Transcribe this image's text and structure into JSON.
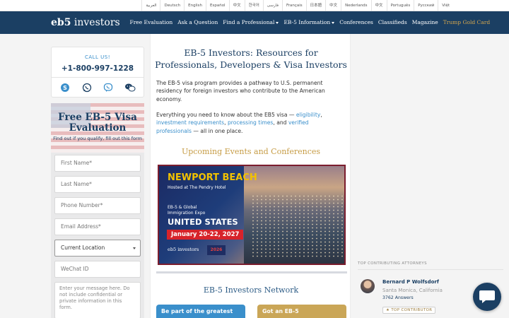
{
  "languages": [
    "العربية",
    "Deutsch",
    "English",
    "Español",
    "中文",
    "한국어",
    "فارسی",
    "Français",
    "日本語",
    "中文",
    "Nederlands",
    "中文",
    "Português",
    "Русский",
    "Việt"
  ],
  "nav": {
    "logo_bold": "eb5",
    "logo_rest": "investors",
    "items": [
      {
        "label": "Free Evaluation"
      },
      {
        "label": "Ask a Question"
      },
      {
        "label": "Find a Professional",
        "dropdown": true
      },
      {
        "label": "EB-5 Information",
        "dropdown": true
      },
      {
        "label": "Conferences"
      },
      {
        "label": "Classifieds"
      },
      {
        "label": "Magazine"
      },
      {
        "label": "Trump Gold Card",
        "accent": "#d6a84e"
      }
    ]
  },
  "sidebar": {
    "call_label": "CALL US!",
    "phone": "+1-800-997-1228",
    "contact_icons": [
      "skype-icon",
      "whatsapp-icon",
      "viber-icon",
      "wechat-icon"
    ],
    "form": {
      "title": "Free EB-5 Visa Evaluation",
      "subtitle": "Find out if you qualify, fill out this form",
      "first_name": "First Name*",
      "last_name": "Last Name*",
      "phone": "Phone Number*",
      "email": "Email Address*",
      "location": "Current Location",
      "wechat": "WeChat ID",
      "message": "Enter your message here. Do not include confidential or private information in this form."
    }
  },
  "main": {
    "title": "EB-5 Investors: Resources for Professionals, Developers & Visa Investors",
    "intro": "The EB-5 visa program provides a pathway to U.S. permanent residency for foreign investors who contribute to the American economy.",
    "para2_prefix": "Everything you need to know about the EB5 visa —",
    "link_eligibility": "eligibility",
    "link_investment": "investment requirements",
    "link_processing": "processing times",
    "para2_and": "and",
    "link_verified": "verified professionals",
    "para2_suffix": "— all in one place.",
    "events_heading": "Upcoming Events and Conferences",
    "banner": {
      "title": "NEWPORT BEACH",
      "subtitle": "Hosted at The Pendry Hotel",
      "expo_line1": "EB-5 & Global",
      "expo_line2": "Immigration Expo",
      "country": "UNITED STATES",
      "dates": "January 20-22, 2027",
      "logo": "eb5 investors",
      "badge": "2026"
    },
    "network_heading": "EB-5 Investors Network",
    "card_left": "Be part of the greatest",
    "card_right": "Got an EB-5"
  },
  "right": {
    "heading": "TOP CONTRIBUTING ATTORNEYS",
    "attorney": {
      "name": "Bernard P Wolfsdorf",
      "location": "Santa Monica, California",
      "answers": "3762 Answers",
      "badge": "TOP CONTRIBUTOR"
    }
  },
  "colors": {
    "navy": "#1b3f63",
    "accent_blue": "#3a8fcb",
    "gold": "#c69c45"
  }
}
